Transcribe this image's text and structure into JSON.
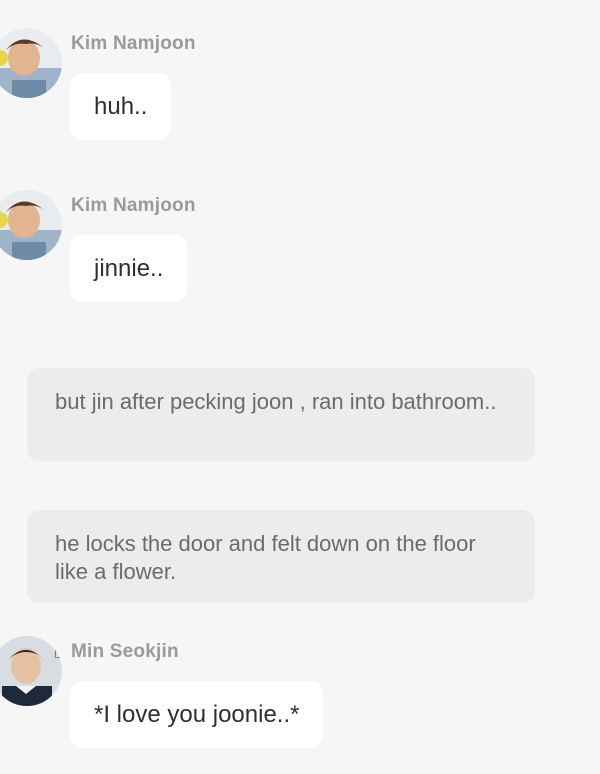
{
  "messages": [
    {
      "kind": "chat",
      "sender": "Kim Namjoon",
      "text": "huh..",
      "avatar_icon": "namjoon-avatar-icon"
    },
    {
      "kind": "chat",
      "sender": "Kim Namjoon",
      "text": "jinnie..",
      "avatar_icon": "namjoon-avatar-icon"
    },
    {
      "kind": "narration",
      "text": "but jin after pecking joon , ran into bathroom.."
    },
    {
      "kind": "narration",
      "text": "he locks the door and felt down on the floor like a flower."
    },
    {
      "kind": "chat",
      "sender": "Min Seokjin",
      "text": "*I love you joonie..*",
      "avatar_icon": "seokjin-avatar-icon",
      "avatar_mark": "L"
    }
  ],
  "colors": {
    "background": "#f6f6f6",
    "bubble": "#ffffff",
    "narration": "#ececec",
    "sender_name": "#9a9a9a"
  }
}
